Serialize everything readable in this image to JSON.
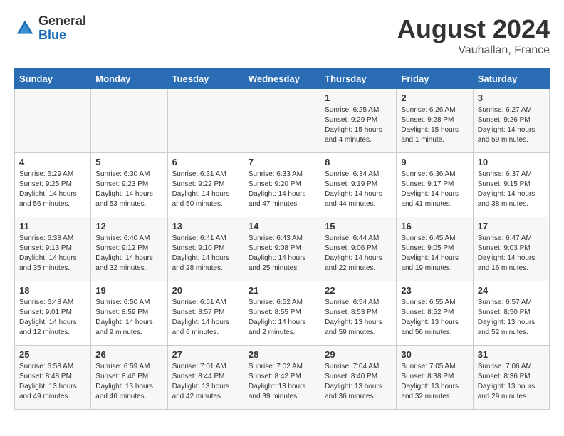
{
  "logo": {
    "general": "General",
    "blue": "Blue"
  },
  "header": {
    "title": "August 2024",
    "subtitle": "Vauhallan, France"
  },
  "weekdays": [
    "Sunday",
    "Monday",
    "Tuesday",
    "Wednesday",
    "Thursday",
    "Friday",
    "Saturday"
  ],
  "weeks": [
    [
      {
        "day": "",
        "info": ""
      },
      {
        "day": "",
        "info": ""
      },
      {
        "day": "",
        "info": ""
      },
      {
        "day": "",
        "info": ""
      },
      {
        "day": "1",
        "info": "Sunrise: 6:25 AM\nSunset: 9:29 PM\nDaylight: 15 hours\nand 4 minutes."
      },
      {
        "day": "2",
        "info": "Sunrise: 6:26 AM\nSunset: 9:28 PM\nDaylight: 15 hours\nand 1 minute."
      },
      {
        "day": "3",
        "info": "Sunrise: 6:27 AM\nSunset: 9:26 PM\nDaylight: 14 hours\nand 59 minutes."
      }
    ],
    [
      {
        "day": "4",
        "info": "Sunrise: 6:29 AM\nSunset: 9:25 PM\nDaylight: 14 hours\nand 56 minutes."
      },
      {
        "day": "5",
        "info": "Sunrise: 6:30 AM\nSunset: 9:23 PM\nDaylight: 14 hours\nand 53 minutes."
      },
      {
        "day": "6",
        "info": "Sunrise: 6:31 AM\nSunset: 9:22 PM\nDaylight: 14 hours\nand 50 minutes."
      },
      {
        "day": "7",
        "info": "Sunrise: 6:33 AM\nSunset: 9:20 PM\nDaylight: 14 hours\nand 47 minutes."
      },
      {
        "day": "8",
        "info": "Sunrise: 6:34 AM\nSunset: 9:19 PM\nDaylight: 14 hours\nand 44 minutes."
      },
      {
        "day": "9",
        "info": "Sunrise: 6:36 AM\nSunset: 9:17 PM\nDaylight: 14 hours\nand 41 minutes."
      },
      {
        "day": "10",
        "info": "Sunrise: 6:37 AM\nSunset: 9:15 PM\nDaylight: 14 hours\nand 38 minutes."
      }
    ],
    [
      {
        "day": "11",
        "info": "Sunrise: 6:38 AM\nSunset: 9:13 PM\nDaylight: 14 hours\nand 35 minutes."
      },
      {
        "day": "12",
        "info": "Sunrise: 6:40 AM\nSunset: 9:12 PM\nDaylight: 14 hours\nand 32 minutes."
      },
      {
        "day": "13",
        "info": "Sunrise: 6:41 AM\nSunset: 9:10 PM\nDaylight: 14 hours\nand 28 minutes."
      },
      {
        "day": "14",
        "info": "Sunrise: 6:43 AM\nSunset: 9:08 PM\nDaylight: 14 hours\nand 25 minutes."
      },
      {
        "day": "15",
        "info": "Sunrise: 6:44 AM\nSunset: 9:06 PM\nDaylight: 14 hours\nand 22 minutes."
      },
      {
        "day": "16",
        "info": "Sunrise: 6:45 AM\nSunset: 9:05 PM\nDaylight: 14 hours\nand 19 minutes."
      },
      {
        "day": "17",
        "info": "Sunrise: 6:47 AM\nSunset: 9:03 PM\nDaylight: 14 hours\nand 16 minutes."
      }
    ],
    [
      {
        "day": "18",
        "info": "Sunrise: 6:48 AM\nSunset: 9:01 PM\nDaylight: 14 hours\nand 12 minutes."
      },
      {
        "day": "19",
        "info": "Sunrise: 6:50 AM\nSunset: 8:59 PM\nDaylight: 14 hours\nand 9 minutes."
      },
      {
        "day": "20",
        "info": "Sunrise: 6:51 AM\nSunset: 8:57 PM\nDaylight: 14 hours\nand 6 minutes."
      },
      {
        "day": "21",
        "info": "Sunrise: 6:52 AM\nSunset: 8:55 PM\nDaylight: 14 hours\nand 2 minutes."
      },
      {
        "day": "22",
        "info": "Sunrise: 6:54 AM\nSunset: 8:53 PM\nDaylight: 13 hours\nand 59 minutes."
      },
      {
        "day": "23",
        "info": "Sunrise: 6:55 AM\nSunset: 8:52 PM\nDaylight: 13 hours\nand 56 minutes."
      },
      {
        "day": "24",
        "info": "Sunrise: 6:57 AM\nSunset: 8:50 PM\nDaylight: 13 hours\nand 52 minutes."
      }
    ],
    [
      {
        "day": "25",
        "info": "Sunrise: 6:58 AM\nSunset: 8:48 PM\nDaylight: 13 hours\nand 49 minutes."
      },
      {
        "day": "26",
        "info": "Sunrise: 6:59 AM\nSunset: 8:46 PM\nDaylight: 13 hours\nand 46 minutes."
      },
      {
        "day": "27",
        "info": "Sunrise: 7:01 AM\nSunset: 8:44 PM\nDaylight: 13 hours\nand 42 minutes."
      },
      {
        "day": "28",
        "info": "Sunrise: 7:02 AM\nSunset: 8:42 PM\nDaylight: 13 hours\nand 39 minutes."
      },
      {
        "day": "29",
        "info": "Sunrise: 7:04 AM\nSunset: 8:40 PM\nDaylight: 13 hours\nand 36 minutes."
      },
      {
        "day": "30",
        "info": "Sunrise: 7:05 AM\nSunset: 8:38 PM\nDaylight: 13 hours\nand 32 minutes."
      },
      {
        "day": "31",
        "info": "Sunrise: 7:06 AM\nSunset: 8:36 PM\nDaylight: 13 hours\nand 29 minutes."
      }
    ]
  ]
}
